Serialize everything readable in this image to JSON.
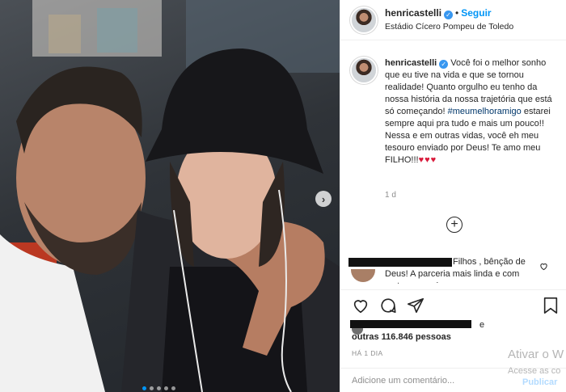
{
  "post": {
    "username": "henricastelli",
    "location": "Estádio Cícero Pompeu de Toledo",
    "follow_label": "Seguir",
    "separator": "•",
    "verified_glyph": "✓"
  },
  "caption": {
    "username": "henricastelli",
    "text_1": " Você foi o melhor sonho que eu tive na vida e que se tornou realidade! Quanto orgulho eu tenho da nossa história da nossa trajetória que está só começando! ",
    "hashtag": "#meumelhoramigo",
    "text_2": " estarei sempre aqui pra tudo e mais um pouco!! Nessa e em outras vidas, você eh meu tesouro enviado por Deus! Te amo meu FILHO!!!",
    "hearts": "♥♥♥",
    "time": "1 d"
  },
  "load_more_label": "+",
  "comment": {
    "text": "Filhos , bênção de Deus! A parceria mais linda e com certeza a mais"
  },
  "likes": {
    "prefix": "e",
    "others": "outras 116.846 pessoas"
  },
  "timestamp": "HÁ 1 DIA",
  "add_comment": {
    "placeholder": "Adicione um comentário...",
    "publish_label": "Publicar"
  },
  "carousel": {
    "next_glyph": "›",
    "slide_count": 5,
    "active_slide": 1
  },
  "watermark": {
    "line1": "Ativar o W",
    "line2": "Acesse as co"
  },
  "icons": [
    "heart-icon",
    "comment-icon",
    "share-icon",
    "bookmark-icon",
    "plus-circle-icon",
    "verified-icon"
  ],
  "colors": {
    "accent": "#0095f6",
    "hashtag": "#00376b",
    "hearts": "#d91a3b",
    "muted": "#8e8e8e"
  }
}
